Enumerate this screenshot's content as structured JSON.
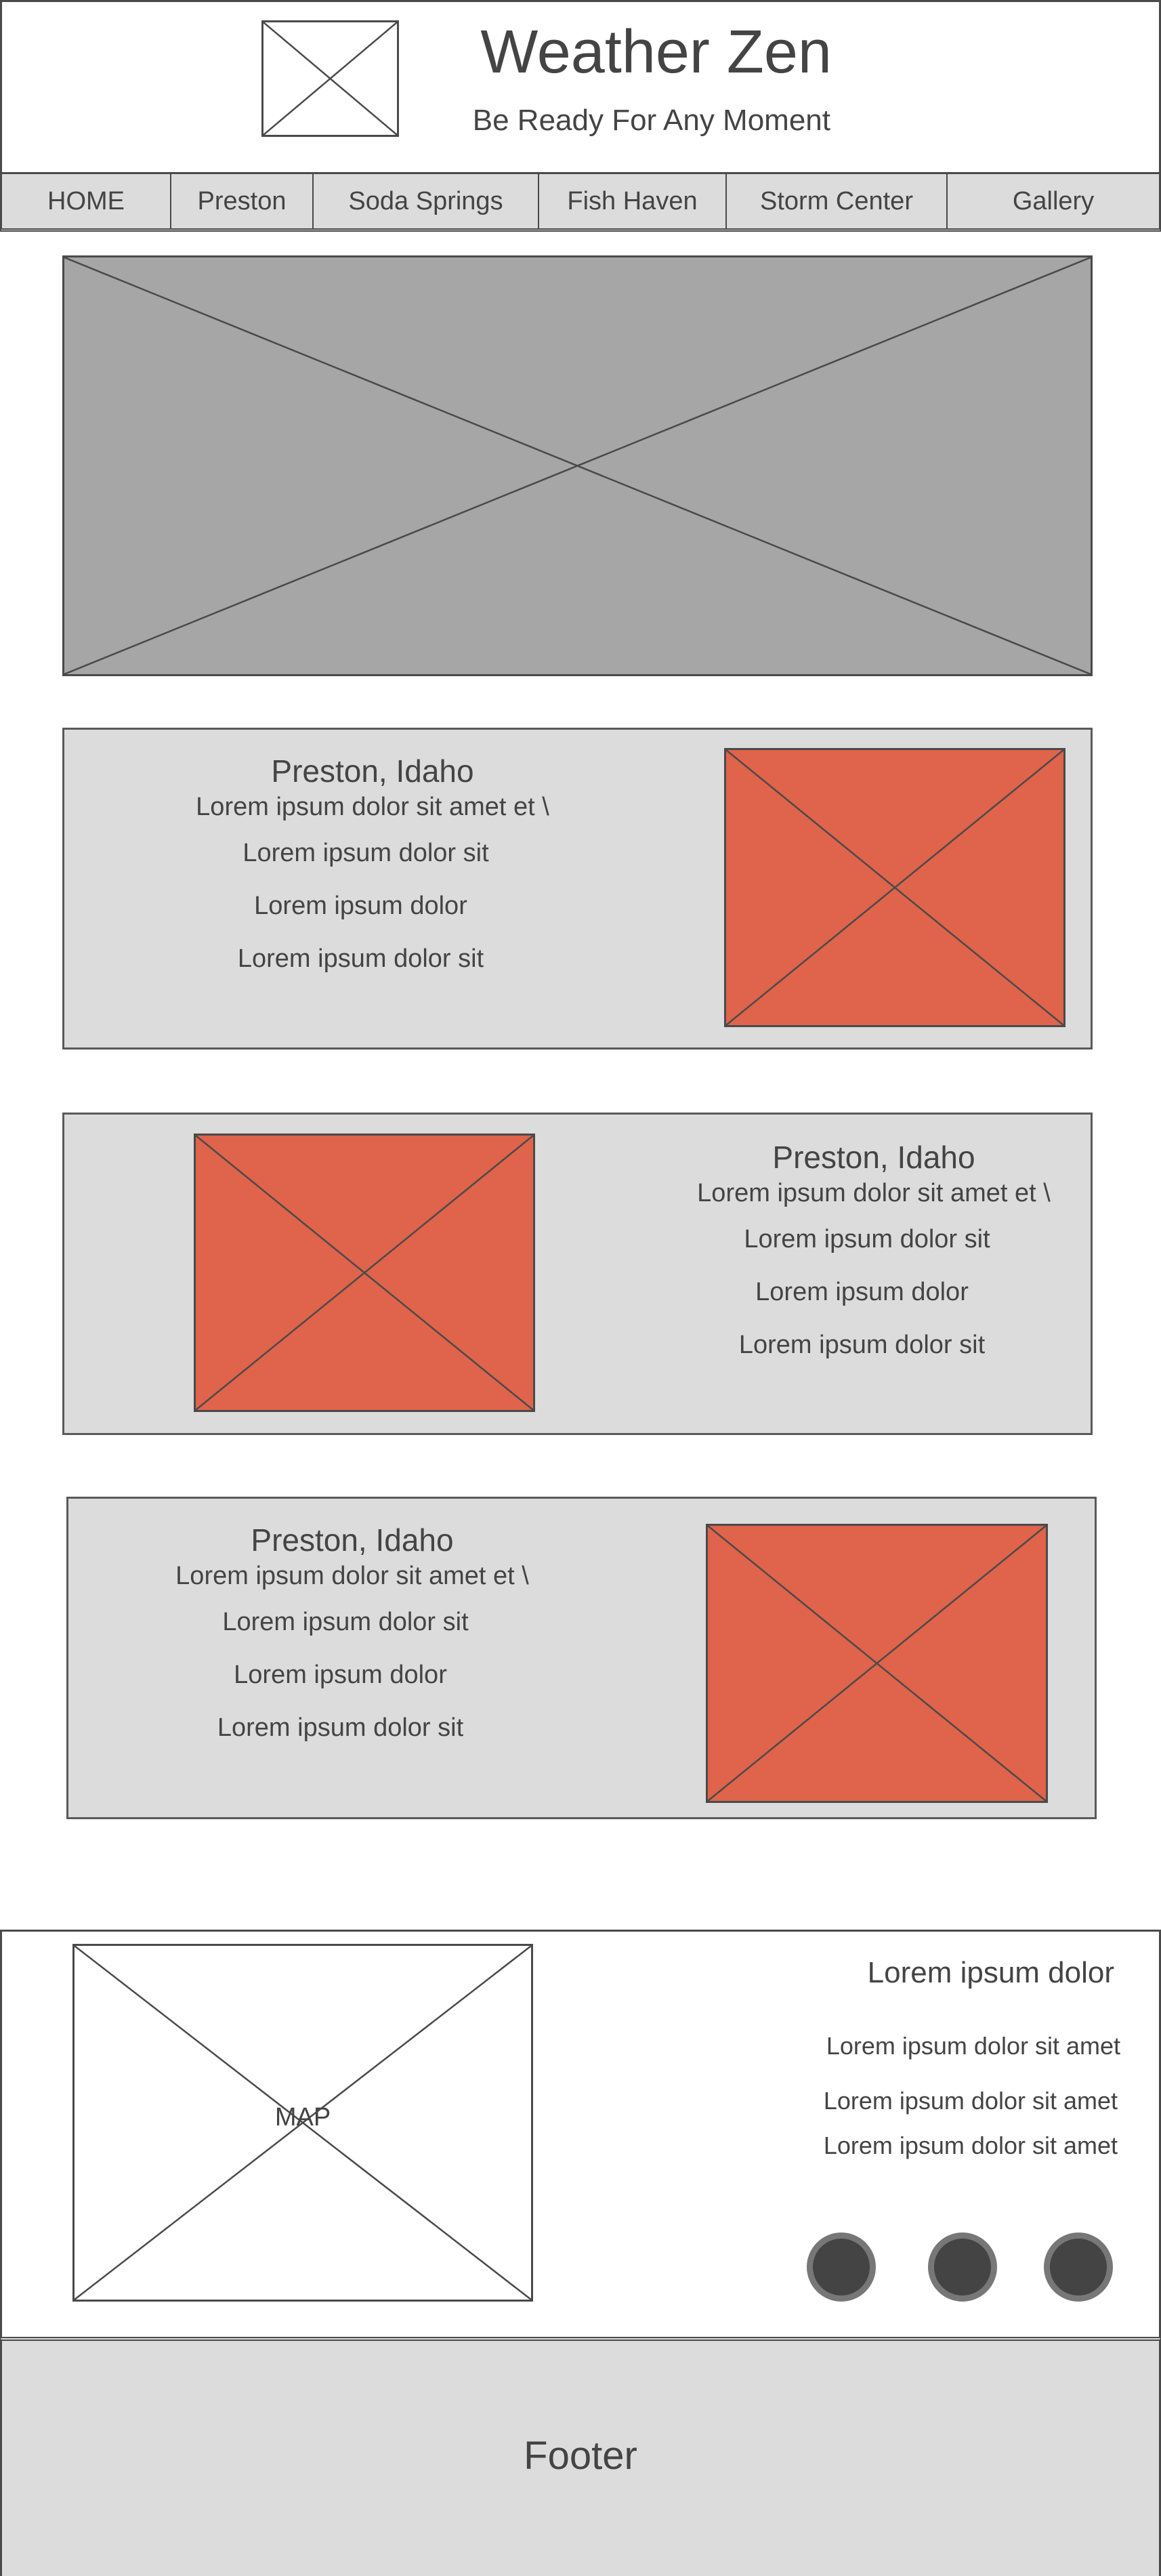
{
  "header": {
    "title": "Weather Zen",
    "tagline": "Be Ready For Any Moment",
    "logo_icon": "image-placeholder-icon"
  },
  "nav": {
    "items": [
      {
        "label": "HOME"
      },
      {
        "label": "Preston"
      },
      {
        "label": "Soda Springs"
      },
      {
        "label": "Fish Haven"
      },
      {
        "label": "Storm Center"
      },
      {
        "label": "Gallery"
      }
    ]
  },
  "hero": {
    "icon": "image-placeholder-icon",
    "color": "#a6a6a6"
  },
  "cards": [
    {
      "title": "Preston, Idaho",
      "lines": [
        "Lorem ipsum dolor sit amet et \\",
        "Lorem ipsum dolor sit",
        "Lorem ipsum dolor",
        "Lorem ipsum dolor sit"
      ],
      "image_side": "right"
    },
    {
      "title": "Preston, Idaho",
      "lines": [
        "Lorem ipsum dolor sit amet et \\",
        "Lorem ipsum dolor sit",
        "Lorem ipsum dolor",
        "Lorem ipsum dolor sit"
      ],
      "image_side": "left"
    },
    {
      "title": "Preston, Idaho",
      "lines": [
        "Lorem ipsum dolor sit amet et \\",
        "Lorem ipsum dolor sit",
        "Lorem ipsum dolor",
        "Lorem ipsum dolor sit"
      ],
      "image_side": "right"
    }
  ],
  "contact": {
    "map_label": "MAP",
    "heading": "Lorem ipsum dolor",
    "lines": [
      "Lorem ipsum dolor sit amet",
      "Lorem ipsum dolor sit amet",
      "Lorem ipsum dolor sit amet"
    ],
    "social_icons": [
      "social-icon-1",
      "social-icon-2",
      "social-icon-3"
    ]
  },
  "footer": {
    "text": "Footer"
  },
  "colors": {
    "accent_image": "#e0634b",
    "panel": "#dcdcdc",
    "hero": "#a6a6a6",
    "text": "#444444",
    "border": "#4a4a4a",
    "social_fill": "#444444",
    "social_ring": "#777777"
  }
}
